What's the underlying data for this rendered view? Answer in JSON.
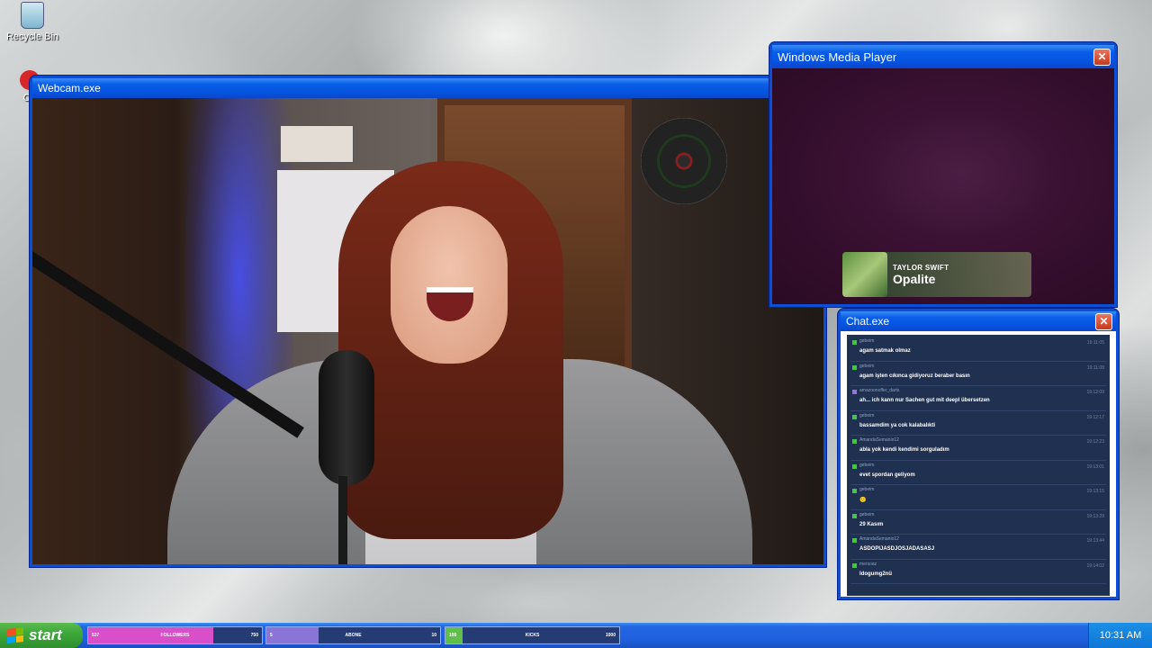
{
  "desktop": {
    "icons": [
      {
        "label": "Recycle Bin"
      },
      {
        "label": "Op"
      }
    ]
  },
  "webcam_window": {
    "title": "Webcam.exe"
  },
  "media_player": {
    "title": "Windows Media Player",
    "now_playing": {
      "artist": "TAYLOR SWIFT",
      "song": "Opalite"
    }
  },
  "chat_window": {
    "title": "Chat.exe",
    "messages": [
      {
        "user": "gebeim",
        "time": "19:11:05",
        "text": "agam satmak olmaz",
        "badge_color": "#3ec93e"
      },
      {
        "user": "gebeim",
        "time": "19:11:08",
        "text": "agam işten cıkınca gidiyoruz beraber basın",
        "badge_color": "#3ec93e"
      },
      {
        "user": "amazoonoffer_darts",
        "time": "19:12:09",
        "text": "ah... ich kann nur Sachen gut mit deepl übersetzen",
        "badge_color": "#9b6ee8"
      },
      {
        "user": "gebeim",
        "time": "19:12:17",
        "text": "bassamdim ya cok kalabalıkti",
        "badge_color": "#3ec93e"
      },
      {
        "user": "AmandaSemanio12",
        "time": "19:12:23",
        "text": "abla yok kendi kendimi sorguladım",
        "badge_color": "#3ec93e"
      },
      {
        "user": "gebeim",
        "time": "19:13:01",
        "text": "evet spordan geliyom",
        "badge_color": "#3ec93e"
      },
      {
        "user": "gebeim",
        "time": "19:13:15",
        "text": "🙂",
        "badge_color": "#3ec93e"
      },
      {
        "user": "gebeim",
        "time": "19:13:29",
        "text": "29 Kasım",
        "badge_color": "#3ec93e"
      },
      {
        "user": "AmandaSemanio12",
        "time": "19:13:44",
        "text": "ASDOPIJASDJOSJADASASJ",
        "badge_color": "#3ec93e"
      },
      {
        "user": "mersoaz",
        "time": "19:14:02",
        "text": "ldogumg2nü",
        "badge_color": "#3ec93e"
      }
    ]
  },
  "taskbar": {
    "start_label": "start",
    "goals": [
      {
        "left": "537",
        "label": "FOLLOWERS",
        "right": "750",
        "progress": 0.72,
        "color": "#d94fc9"
      },
      {
        "left": "5",
        "label": "ABONE",
        "right": "10",
        "progress": 0.3,
        "color": "#8a74d6"
      },
      {
        "left": "100",
        "label": "KICKS",
        "right": "1000",
        "progress": 0.1,
        "color": "#5fbf4a"
      }
    ],
    "clock": "10:31 AM"
  }
}
